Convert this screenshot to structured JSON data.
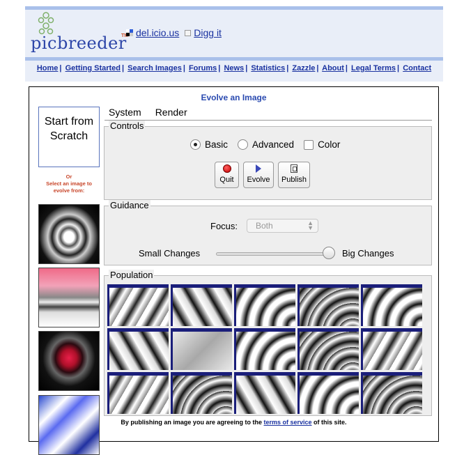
{
  "header": {
    "logo_text": "picbreeder",
    "logo_tm": "TM",
    "delicious_label": "del.icio.us",
    "digg_label": "Digg it"
  },
  "nav": {
    "items": [
      "Home",
      "Getting Started",
      "Search Images",
      "Forums",
      "News",
      "Statistics",
      "Zazzle",
      "About",
      "Legal Terms",
      "Contact"
    ],
    "separator": "|"
  },
  "main": {
    "title": "Evolve an Image",
    "start_button": "Start from Scratch",
    "or_text": "Or",
    "select_text": "Select an image to evolve from:"
  },
  "tabs": [
    "System",
    "Render"
  ],
  "controls": {
    "label": "Controls",
    "mode_options": [
      {
        "label": "Basic",
        "selected": true
      },
      {
        "label": "Advanced",
        "selected": false
      }
    ],
    "color_label": "Color",
    "color_checked": false,
    "buttons": [
      "Quit",
      "Evolve",
      "Publish"
    ]
  },
  "guidance": {
    "label": "Guidance",
    "focus_label": "Focus:",
    "focus_value": "Both",
    "small_label": "Small Changes",
    "big_label": "Big Changes",
    "slider_level": 0.95
  },
  "population": {
    "label": "Population",
    "rows": 3,
    "cols": 5
  },
  "footer": {
    "prefix": "By publishing an image you are agreeing to the",
    "link": "terms of service",
    "suffix": "of this site."
  },
  "colors": {
    "accent": "#2a4ab0",
    "header_bg": "#e9eef8",
    "header_strip": "#a9c0ea",
    "cell_border": "#1a1e7a",
    "or_text": "#c8462a"
  }
}
